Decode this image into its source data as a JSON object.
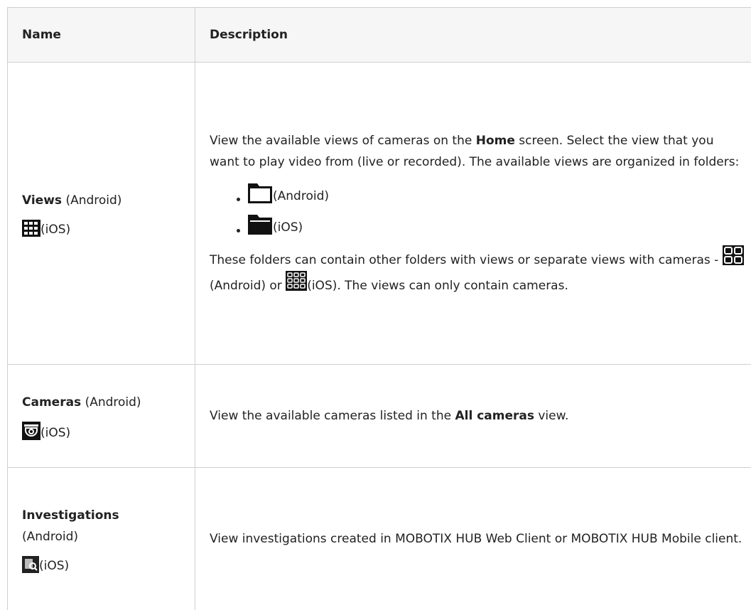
{
  "table": {
    "headers": {
      "name": "Name",
      "description": "Description"
    },
    "rows": [
      {
        "name_bold": "Views",
        "name_rest": " (Android)",
        "ios_label": "(iOS)",
        "icon": "grid-icon",
        "desc_p1_a": "View the available views of cameras on the ",
        "desc_p1_b": "Home",
        "desc_p1_c": " screen. Select the view that you want to play video from (live or recorded). The available views are organized in folders:",
        "bullets": [
          {
            "icon": "folder-outline-icon",
            "label": "(Android)"
          },
          {
            "icon": "folder-filled-icon",
            "label": "(iOS)"
          }
        ],
        "desc_p2_a": "These folders can contain other folders with views or separate views with cameras - ",
        "desc_p2_b": "(Android) or ",
        "desc_p2_c": "(iOS). The views can only contain cameras."
      },
      {
        "name_bold": "Cameras",
        "name_rest": " (Android)",
        "ios_label": "(iOS)",
        "icon": "camera-dome-icon",
        "desc_a": "View the available cameras listed in the ",
        "desc_b": "All cameras",
        "desc_c": " view."
      },
      {
        "name_bold": "Investigations",
        "name_rest": "(Android)",
        "ios_label": "(iOS)",
        "icon": "investigation-icon",
        "desc": "View investigations created in MOBOTIX HUB Web Client or MOBOTIX HUB Mobile client."
      }
    ]
  }
}
